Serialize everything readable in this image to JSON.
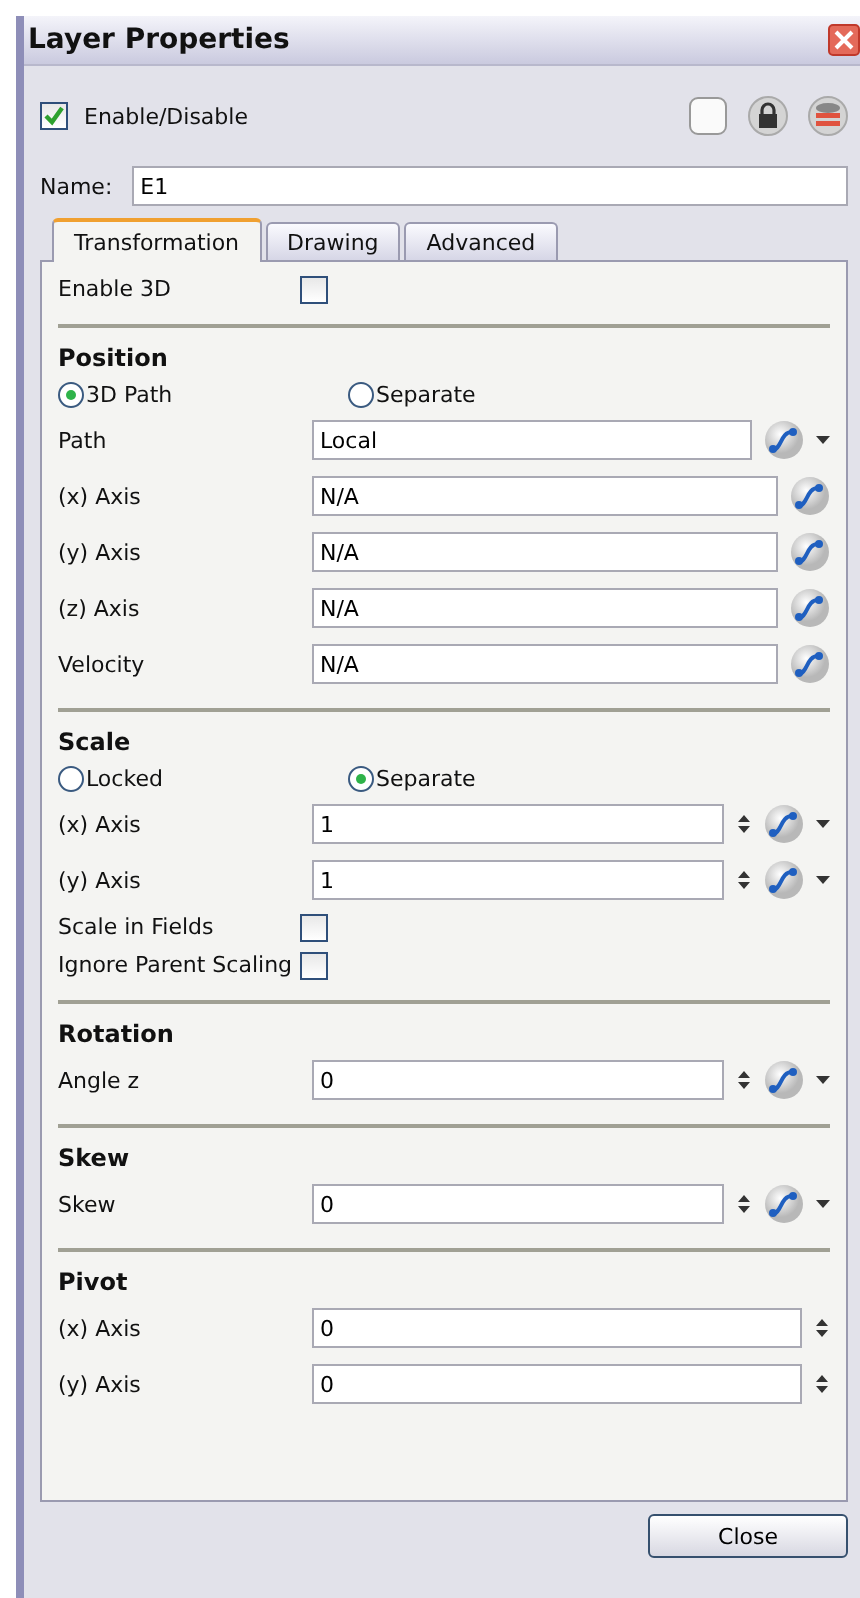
{
  "window": {
    "title": "Layer Properties"
  },
  "enable": {
    "label": "Enable/Disable",
    "checked": true
  },
  "name_field": {
    "label": "Name:",
    "value": "E1"
  },
  "tabs": [
    {
      "label": "Transformation",
      "selected": true
    },
    {
      "label": "Drawing",
      "selected": false
    },
    {
      "label": "Advanced",
      "selected": false
    }
  ],
  "sections": [
    {
      "rows": [
        {
          "kind": "checkbox",
          "label": "Enable 3D",
          "checked": false
        }
      ]
    },
    {
      "heading": "Position",
      "radios": [
        {
          "label": "3D Path",
          "selected": true
        },
        {
          "label": "Separate",
          "selected": false
        }
      ],
      "rows": [
        {
          "kind": "field",
          "label": "Path",
          "value": "Local",
          "spinner": false,
          "curve": true,
          "dropdown": true
        },
        {
          "kind": "field",
          "label": "(x) Axis",
          "value": "N/A",
          "spinner": false,
          "curve": true,
          "dropdown": false
        },
        {
          "kind": "field",
          "label": "(y) Axis",
          "value": "N/A",
          "spinner": false,
          "curve": true,
          "dropdown": false
        },
        {
          "kind": "field",
          "label": "(z) Axis",
          "value": "N/A",
          "spinner": false,
          "curve": true,
          "dropdown": false
        },
        {
          "kind": "field",
          "label": "Velocity",
          "value": "N/A",
          "spinner": false,
          "curve": true,
          "dropdown": false
        }
      ]
    },
    {
      "heading": "Scale",
      "radios": [
        {
          "label": "Locked",
          "selected": false
        },
        {
          "label": "Separate",
          "selected": true
        }
      ],
      "rows": [
        {
          "kind": "field",
          "label": "(x) Axis",
          "value": "1",
          "spinner": true,
          "curve": true,
          "dropdown": true
        },
        {
          "kind": "field",
          "label": "(y) Axis",
          "value": "1",
          "spinner": true,
          "curve": true,
          "dropdown": true
        },
        {
          "kind": "checkbox",
          "label": "Scale in Fields",
          "checked": false
        },
        {
          "kind": "checkbox",
          "label": "Ignore Parent Scaling",
          "checked": false
        }
      ]
    },
    {
      "heading": "Rotation",
      "rows": [
        {
          "kind": "field",
          "label": "Angle z",
          "value": "0",
          "spinner": true,
          "curve": true,
          "dropdown": true
        }
      ]
    },
    {
      "heading": "Skew",
      "rows": [
        {
          "kind": "field",
          "label": "Skew",
          "value": "0",
          "spinner": true,
          "curve": true,
          "dropdown": true
        }
      ]
    },
    {
      "heading": "Pivot",
      "rows": [
        {
          "kind": "field",
          "label": "(x) Axis",
          "value": "0",
          "spinner": true,
          "curve": false,
          "dropdown": false
        },
        {
          "kind": "field",
          "label": "(y) Axis",
          "value": "0",
          "spinner": true,
          "curve": false,
          "dropdown": false
        }
      ]
    }
  ],
  "close_button": "Close"
}
